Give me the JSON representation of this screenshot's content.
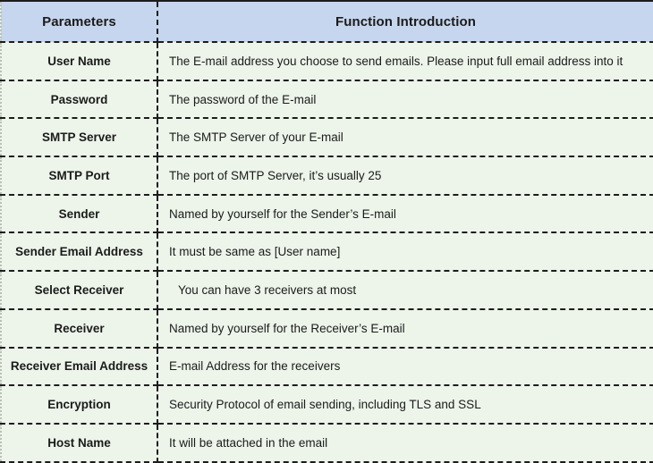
{
  "table": {
    "headers": {
      "parameter": "Parameters",
      "description": "Function Introduction"
    },
    "colors": {
      "header_background": "#c6d6ee",
      "body_background": "#edf5ea",
      "text": "#1b1b1b",
      "border_dark": "#1c1c1c",
      "border_light": "#b9bfb6"
    },
    "rows": [
      {
        "parameter": "User Name",
        "description": "The E-mail address you choose to send emails. Please input full email address into it",
        "indented": false
      },
      {
        "parameter": "Password",
        "description": "The password of the E-mail",
        "indented": false
      },
      {
        "parameter": "SMTP Server",
        "description": "The SMTP Server of your E-mail",
        "indented": false
      },
      {
        "parameter": "SMTP Port",
        "description": "The port of SMTP Server, it’s usually 25",
        "indented": false
      },
      {
        "parameter": "Sender",
        "description": "Named by yourself for the Sender’s E-mail",
        "indented": false
      },
      {
        "parameter": "Sender Email Address",
        "description": "It must be same as [User name]",
        "indented": false
      },
      {
        "parameter": "Select Receiver",
        "description": "You can have 3 receivers at most",
        "indented": true
      },
      {
        "parameter": "Receiver",
        "description": "Named by yourself for the Receiver’s E-mail",
        "indented": false
      },
      {
        "parameter": "Receiver Email Address",
        "description": "E-mail Address for the receivers",
        "indented": false
      },
      {
        "parameter": "Encryption",
        "description": "Security Protocol of email sending, including TLS and SSL",
        "indented": false
      },
      {
        "parameter": "Host Name",
        "description": "It will be attached in the email",
        "indented": false
      }
    ]
  }
}
